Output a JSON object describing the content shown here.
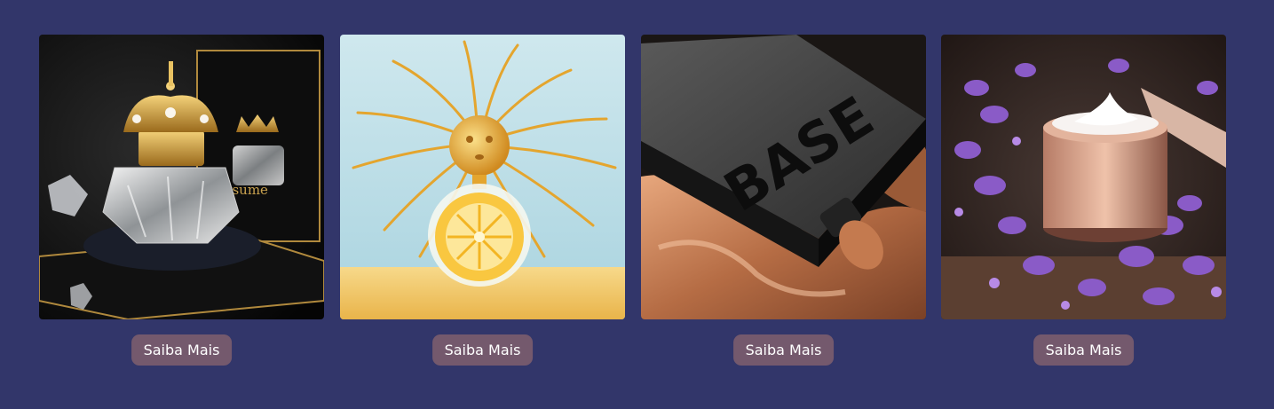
{
  "products": [
    {
      "image_label": "perfume-with-crown-image",
      "button_label": "Saiba Mais",
      "image_text": "Qrsume"
    },
    {
      "image_label": "sun-lemon-perfume-image",
      "button_label": "Saiba Mais"
    },
    {
      "image_label": "base-foundation-image",
      "button_label": "Saiba Mais",
      "image_text": "BASE"
    },
    {
      "image_label": "lavender-cream-jar-image",
      "button_label": "Saiba Mais"
    }
  ],
  "colors": {
    "background": "#32366a",
    "button": "#74596d",
    "button_text": "#ffffff"
  }
}
